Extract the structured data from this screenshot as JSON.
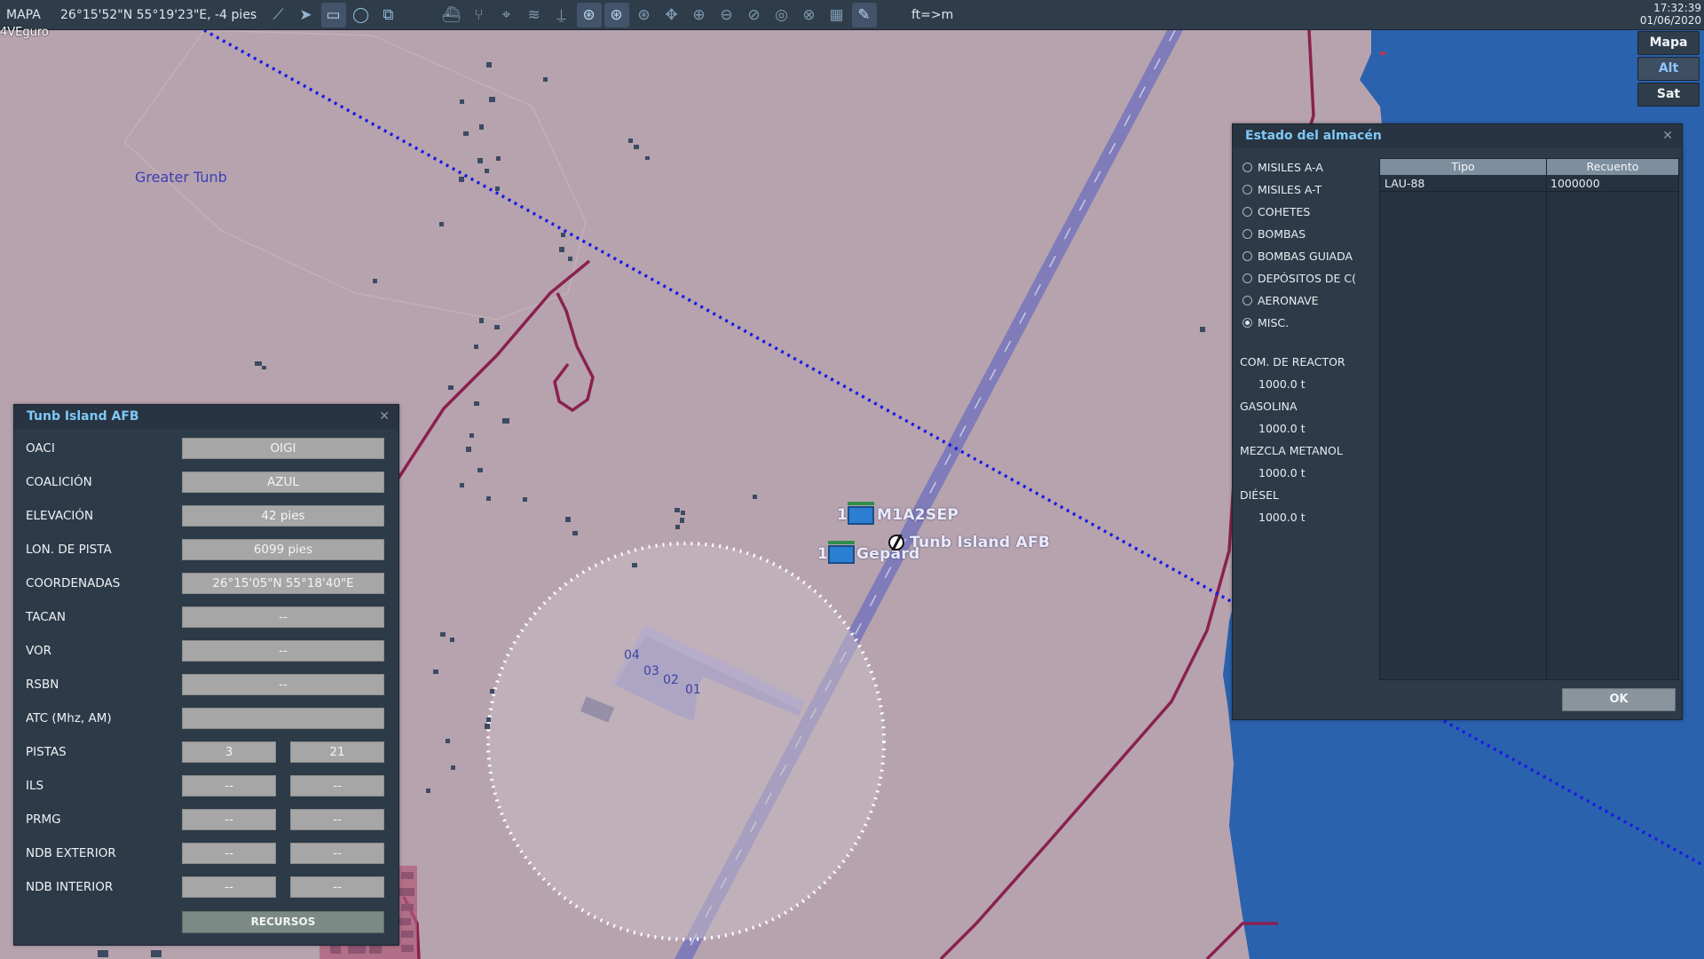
{
  "toolbar": {
    "mode": "MAPA",
    "coordinates": "26°15'52\"N 55°19'23\"E, -4 pies",
    "units_toggle": "ft=>m",
    "time": "17:32:39",
    "date": "01/06/2020",
    "icons": [
      "route-icon",
      "navigation-icon",
      "unit-select-icon",
      "circle-icon",
      "layers-icon",
      "ship-icon",
      "branch-icon",
      "target-icon",
      "wifi-icon",
      "antenna-icon",
      "zoom-region-icon",
      "zoom-region-alt-icon",
      "zoom-region-third-icon",
      "pan-icon",
      "zoom-in-icon",
      "zoom-out-icon",
      "zoom-fit-icon",
      "radar-icon",
      "globe-icon",
      "grid-icon",
      "pencil-icon"
    ]
  },
  "corner_label": "4VEguro",
  "map_types": [
    "Mapa",
    "Alt",
    "Sat"
  ],
  "map": {
    "place_label": "Greater Tunb",
    "airbase_label": "Tunb Island AFB",
    "units": [
      {
        "count": "1",
        "name": "M1A2SEP"
      },
      {
        "count": "1",
        "name": "Gepard"
      }
    ],
    "runway_numbers": [
      "04",
      "03",
      "02",
      "01"
    ]
  },
  "airbase_panel": {
    "title": "Tunb Island AFB",
    "rows": [
      {
        "label": "OACI",
        "value": "OIGI"
      },
      {
        "label": "COALICIÓN",
        "value": "AZUL"
      },
      {
        "label": "ELEVACIÓN",
        "value": "42 pies"
      },
      {
        "label": "LON. DE PISTA",
        "value": "6099 pies"
      },
      {
        "label": "COORDENADAS",
        "value": "26°15'05\"N 55°18'40\"E"
      },
      {
        "label": "TACAN",
        "value": "--"
      },
      {
        "label": "VOR",
        "value": "--"
      },
      {
        "label": "RSBN",
        "value": "--"
      },
      {
        "label": "ATC  (Mhz, AM)",
        "value": ""
      }
    ],
    "pair_rows": [
      {
        "label": "PISTAS",
        "v1": "3",
        "v2": "21"
      },
      {
        "label": "ILS",
        "v1": "--",
        "v2": "--"
      },
      {
        "label": "PRMG",
        "v1": "--",
        "v2": "--"
      },
      {
        "label": "NDB EXTERIOR",
        "v1": "--",
        "v2": "--"
      },
      {
        "label": "NDB INTERIOR",
        "v1": "--",
        "v2": "--"
      }
    ],
    "resources_button": "RECURSOS"
  },
  "warehouse_panel": {
    "title": "Estado del almacén",
    "categories": [
      {
        "label": "MISILES A-A",
        "selected": false
      },
      {
        "label": "MISILES A-T",
        "selected": false
      },
      {
        "label": "COHETES",
        "selected": false
      },
      {
        "label": "BOMBAS",
        "selected": false
      },
      {
        "label": "BOMBAS GUIADA",
        "selected": false
      },
      {
        "label": "DEPÓSITOS DE C(",
        "selected": false
      },
      {
        "label": "AERONAVE",
        "selected": false
      },
      {
        "label": "MISC.",
        "selected": true
      }
    ],
    "fuels": [
      {
        "label": "COM. DE REACTOR",
        "value": "1000.0 t"
      },
      {
        "label": "GASOLINA",
        "value": "1000.0 t"
      },
      {
        "label": "MEZCLA METANOL",
        "value": "1000.0 t"
      },
      {
        "label": "DIÉSEL",
        "value": "1000.0 t"
      }
    ],
    "table": {
      "columns": [
        "Tipo",
        "Recuento"
      ],
      "rows": [
        [
          "LAU-88",
          "1000000"
        ]
      ]
    },
    "ok_button": "OK"
  }
}
